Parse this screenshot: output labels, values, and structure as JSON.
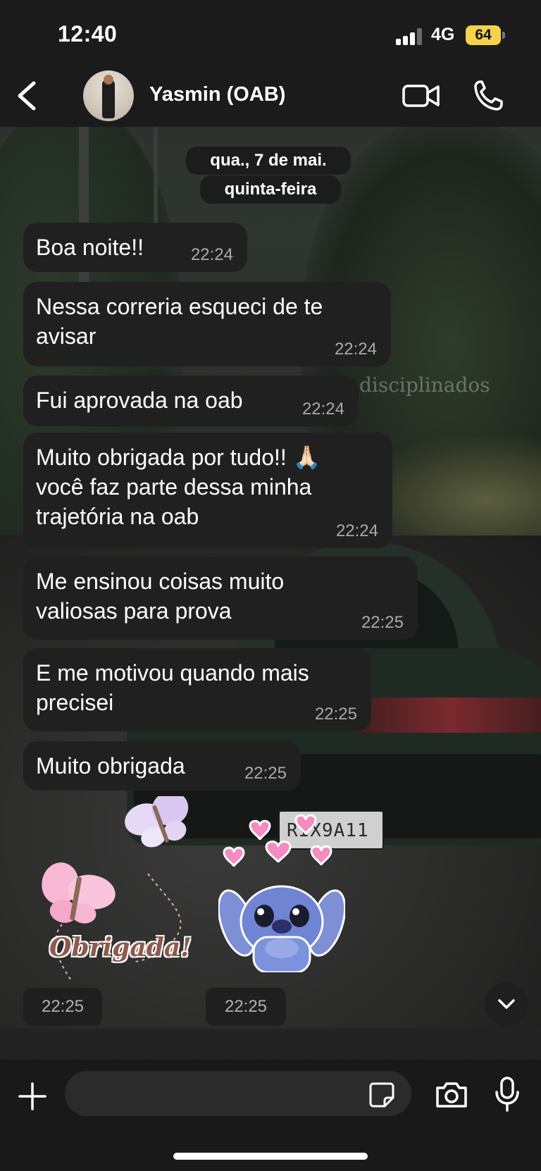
{
  "status_bar": {
    "time": "12:40",
    "network": "4G",
    "battery": "64",
    "battery_color": "#f2d34a"
  },
  "header": {
    "contact_name": "Yasmin (OAB)",
    "back_icon": "chevron-left-icon",
    "video_icon": "video-camera-icon",
    "call_icon": "phone-icon"
  },
  "date_dividers": [
    "qua., 7 de mai.",
    "quinta-feira"
  ],
  "wallpaper": {
    "watermark": "disciplinados",
    "plate": "RIX9A11"
  },
  "messages": [
    {
      "text": "Boa noite!!",
      "time": "22:24"
    },
    {
      "text": "Nessa correria esqueci de te\navisar",
      "time": "22:24"
    },
    {
      "text": "Fui aprovada na oab",
      "time": "22:24"
    },
    {
      "text": "Muito obrigada por tudo!! 🙏🏻\nvocê faz parte dessa minha\ntrajetória na oab",
      "time": "22:24"
    },
    {
      "text": "Me ensinou coisas muito\nvaliosas para prova",
      "time": "22:25"
    },
    {
      "text": "E me motivou quando mais\nprecisei",
      "time": "22:25"
    },
    {
      "text": "Muito obrigada",
      "time": "22:25"
    }
  ],
  "stickers": [
    {
      "name": "butterflies-obrigada-sticker",
      "text": "Obrigada!",
      "time": "22:25"
    },
    {
      "name": "stitch-hearts-sticker",
      "time": "22:25"
    }
  ],
  "composer": {
    "placeholder": "",
    "plus_icon": "plus-icon",
    "sticker_icon": "sticker-icon",
    "camera_icon": "camera-icon",
    "mic_icon": "microphone-icon"
  },
  "colors": {
    "bubble": "#202020",
    "bar": "#1b1b1b",
    "timestamp": "#a9a9a9"
  }
}
